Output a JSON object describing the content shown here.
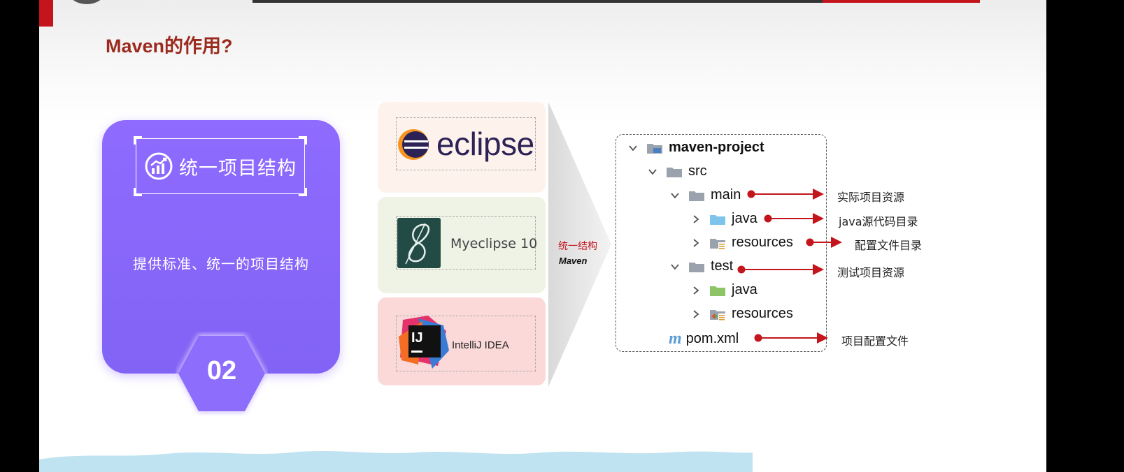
{
  "title": "Maven的作用?",
  "card": {
    "heading": "统一项目结构",
    "description": "提供标准、统一的项目结构",
    "number": "02",
    "icon": "chart-up-icon"
  },
  "ides": [
    {
      "name": "eclipse",
      "icon": "eclipse-logo-icon"
    },
    {
      "name": "Myeclipse 10",
      "icon": "myeclipse-logo-icon"
    },
    {
      "name": "IntelliJ IDEA",
      "icon": "intellij-logo-icon"
    }
  ],
  "arrow": {
    "label": "统一结构",
    "sublabel": "Maven"
  },
  "tree": [
    {
      "name": "maven-project",
      "expanded": true,
      "icon": "module-folder-icon"
    },
    {
      "name": "src",
      "expanded": true,
      "icon": "folder-icon"
    },
    {
      "name": "main",
      "expanded": true,
      "icon": "folder-icon"
    },
    {
      "name": "java",
      "expanded": false,
      "icon": "source-folder-icon"
    },
    {
      "name": "resources",
      "expanded": false,
      "icon": "resources-folder-icon"
    },
    {
      "name": "test",
      "expanded": true,
      "icon": "folder-icon"
    },
    {
      "name": "java",
      "expanded": false,
      "icon": "test-source-folder-icon"
    },
    {
      "name": "resources",
      "expanded": false,
      "icon": "test-resources-folder-icon"
    },
    {
      "name": "pom.xml",
      "icon": "maven-file-icon"
    }
  ],
  "notes": {
    "main": "实际项目资源",
    "java": "java源代码目录",
    "resources": "配置文件目录",
    "test": "测试项目资源",
    "pom": "项目配置文件"
  },
  "colors": {
    "accent": "#c4141c",
    "title": "#9b2a1e",
    "card": "#8b6cfb"
  }
}
